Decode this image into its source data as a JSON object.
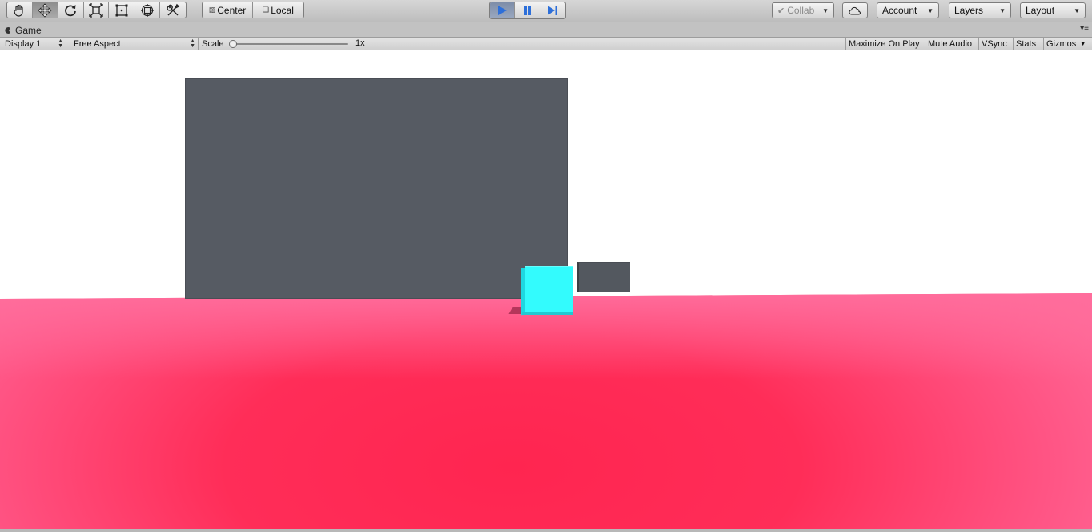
{
  "toolbar": {
    "tools": [
      {
        "name": "hand-tool",
        "icon": "hand-icon"
      },
      {
        "name": "move-tool",
        "icon": "move-icon",
        "active": true
      },
      {
        "name": "rotate-tool",
        "icon": "rotate-icon"
      },
      {
        "name": "scale-tool",
        "icon": "scale-icon"
      },
      {
        "name": "rect-tool",
        "icon": "rect-icon"
      },
      {
        "name": "transform-tool",
        "icon": "transform-icon"
      },
      {
        "name": "custom-tool",
        "icon": "tools-icon"
      }
    ],
    "pivot_label": "Center",
    "rotation_label": "Local",
    "play_controls": {
      "play_active": true,
      "accent_color": "#2d6fd9"
    },
    "collab_label": "Collab",
    "account_label": "Account",
    "layers_label": "Layers",
    "layout_label": "Layout"
  },
  "tab": {
    "title": "Game"
  },
  "gamebar": {
    "display_label": "Display 1",
    "aspect_label": "Free Aspect",
    "scale_label": "Scale",
    "scale_value": "1x",
    "maximize_label": "Maximize On Play",
    "mute_label": "Mute Audio",
    "vsync_label": "VSync",
    "stats_label": "Stats",
    "gizmos_label": "Gizmos"
  },
  "scene": {
    "background_color": "#ffffff",
    "ground_color": "#ff2d58",
    "wall_color": "#565b63",
    "cube_color": "#33fbfd"
  }
}
